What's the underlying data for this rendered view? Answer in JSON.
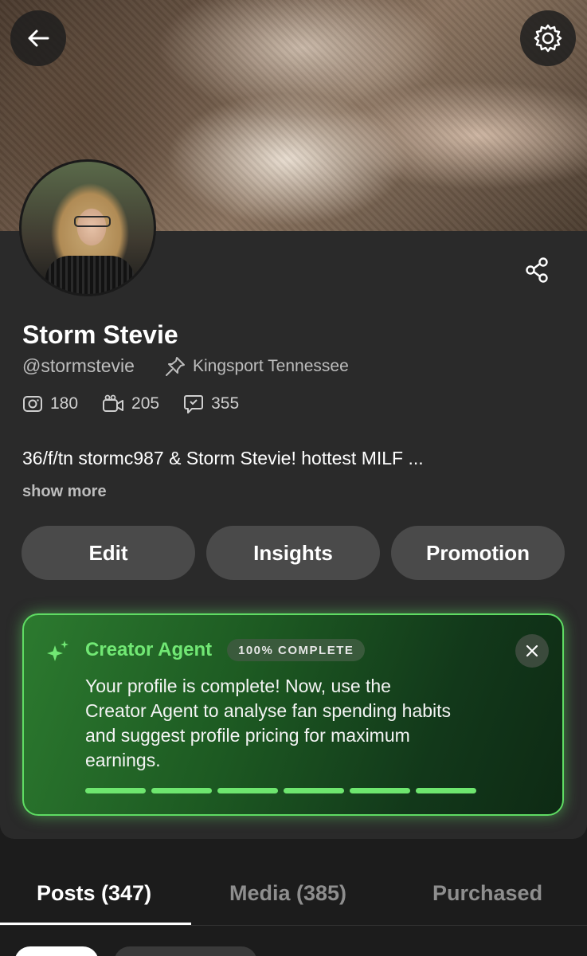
{
  "profile": {
    "name": "Storm Stevie",
    "handle": "@stormstevie",
    "location": "Kingsport Tennessee",
    "stats": {
      "photos": "180",
      "videos": "205",
      "streams": "355"
    },
    "bio": "36/f/tn stormc987 & Storm Stevie! hottest MILF ...",
    "show_more": "show more"
  },
  "actions": {
    "edit": "Edit",
    "insights": "Insights",
    "promotion": "Promotion"
  },
  "agent": {
    "title": "Creator Agent",
    "badge": "100% COMPLETE",
    "message": "Your profile is complete! Now, use the Creator Agent to analyse fan spending habits and suggest profile pricing for maximum earnings.",
    "progress_fraction": 1.0,
    "accent": "#71e874"
  },
  "tabs": {
    "posts": "Posts (347)",
    "media": "Media (385)",
    "purchased": "Purchased"
  },
  "icons": {
    "back": "arrow-left-icon",
    "settings": "gear-icon",
    "share": "share-icon",
    "location": "pin-icon",
    "photos": "camera-icon",
    "videos": "video-icon",
    "streams": "chat-bubble-icon",
    "sparkle": "sparkle-icon",
    "close": "close-icon"
  }
}
